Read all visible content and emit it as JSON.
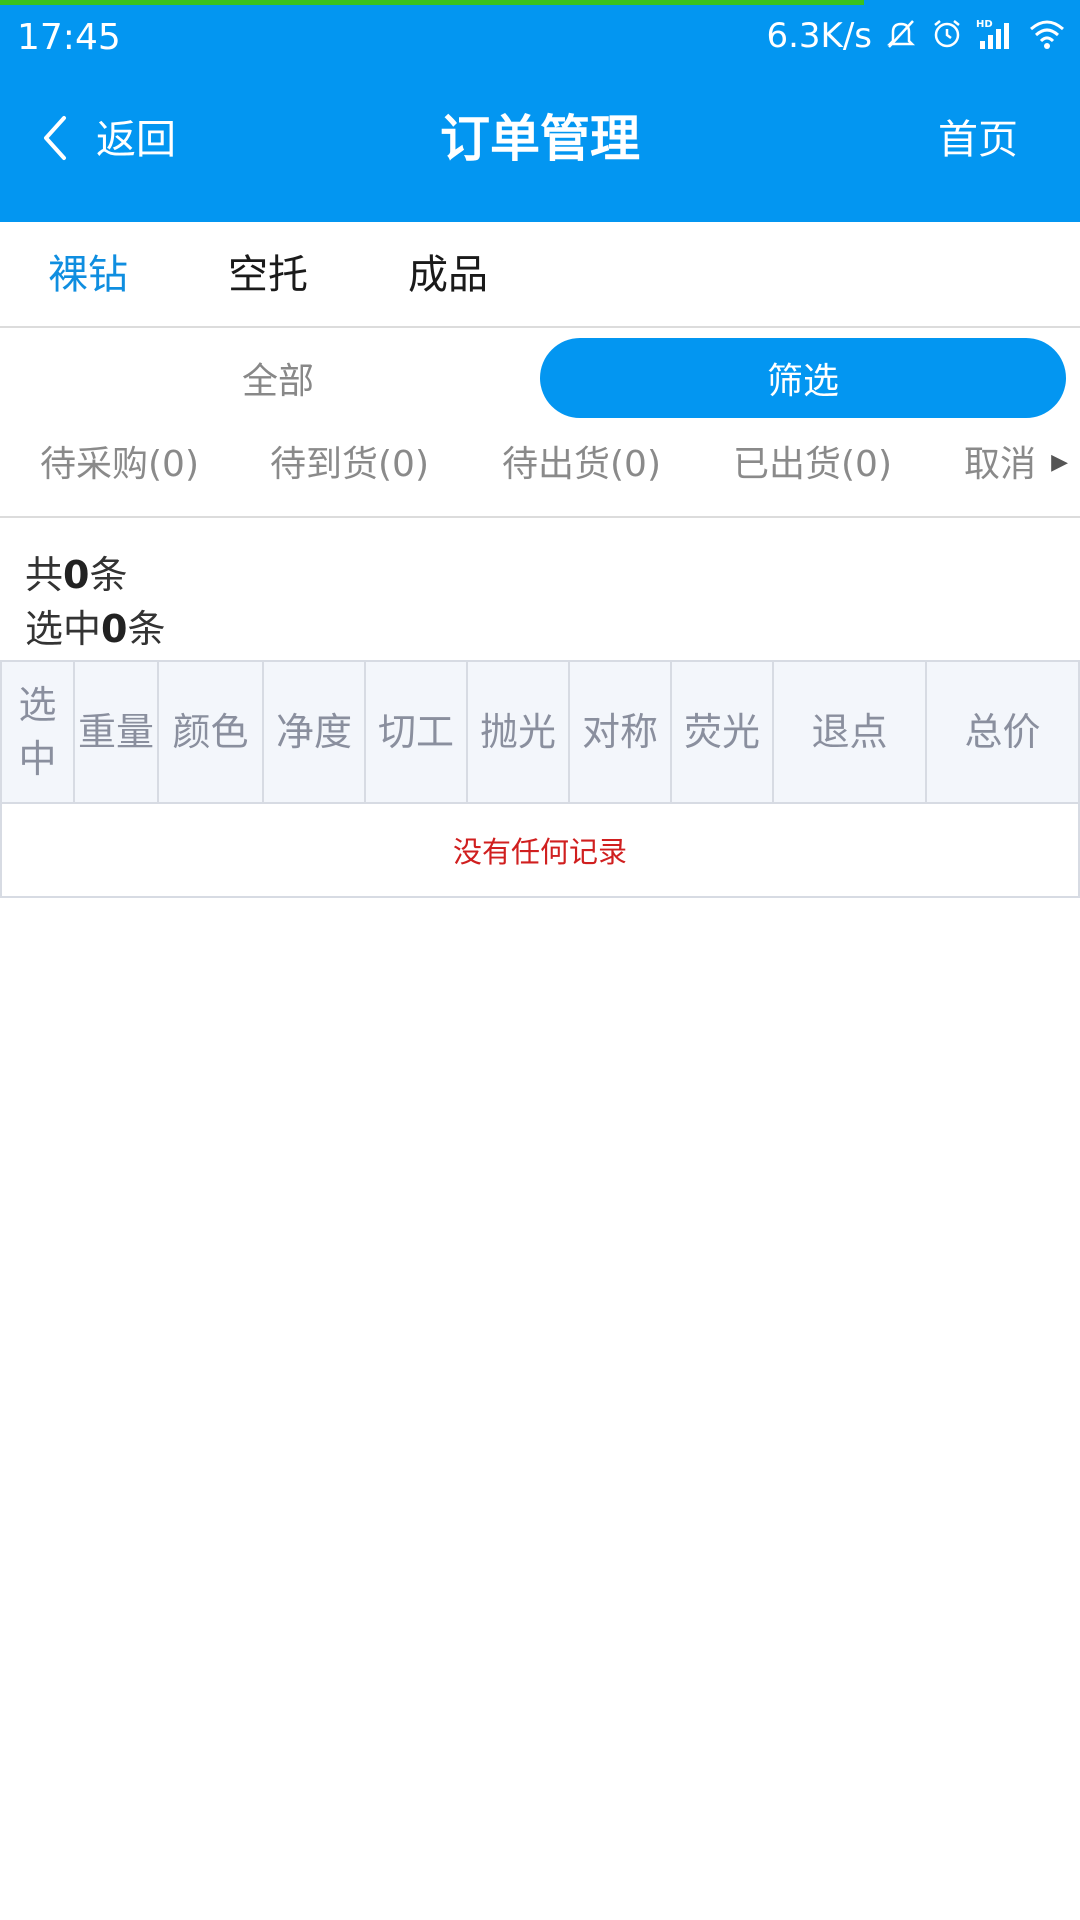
{
  "status_bar": {
    "time": "17:45",
    "net_speed": "6.3K/s",
    "icons": [
      "mute-bell-icon",
      "alarm-icon",
      "hd-signal-icon",
      "wifi-icon"
    ]
  },
  "page_load_progress": 0.8,
  "nav": {
    "back_label": "返回",
    "title": "订单管理",
    "home_label": "首页"
  },
  "category_tabs": {
    "items": [
      {
        "label": "裸钻",
        "active": true
      },
      {
        "label": "空托",
        "active": false
      },
      {
        "label": "成品",
        "active": false
      }
    ]
  },
  "segment": {
    "all_label": "全部",
    "filter_label": "筛选"
  },
  "status_tabs": {
    "items": [
      {
        "label": "待采购(0)"
      },
      {
        "label": "待到货(0)"
      },
      {
        "label": "待出货(0)"
      },
      {
        "label": "已出货(0)"
      },
      {
        "label": "取消"
      }
    ]
  },
  "counts": {
    "total_prefix": "共",
    "total": "0",
    "total_suffix": "条",
    "selected_prefix": "选中",
    "selected": "0",
    "selected_suffix": "条"
  },
  "table": {
    "columns": [
      "选中",
      "重量",
      "颜色",
      "净度",
      "切工",
      "抛光",
      "对称",
      "荧光",
      "退点",
      "总价"
    ],
    "empty_text": "没有任何记录"
  },
  "colors": {
    "primary": "#0396f1",
    "active_tab": "#0f8ee0",
    "progress": "#39c21f",
    "empty_text": "#d01f1f"
  }
}
